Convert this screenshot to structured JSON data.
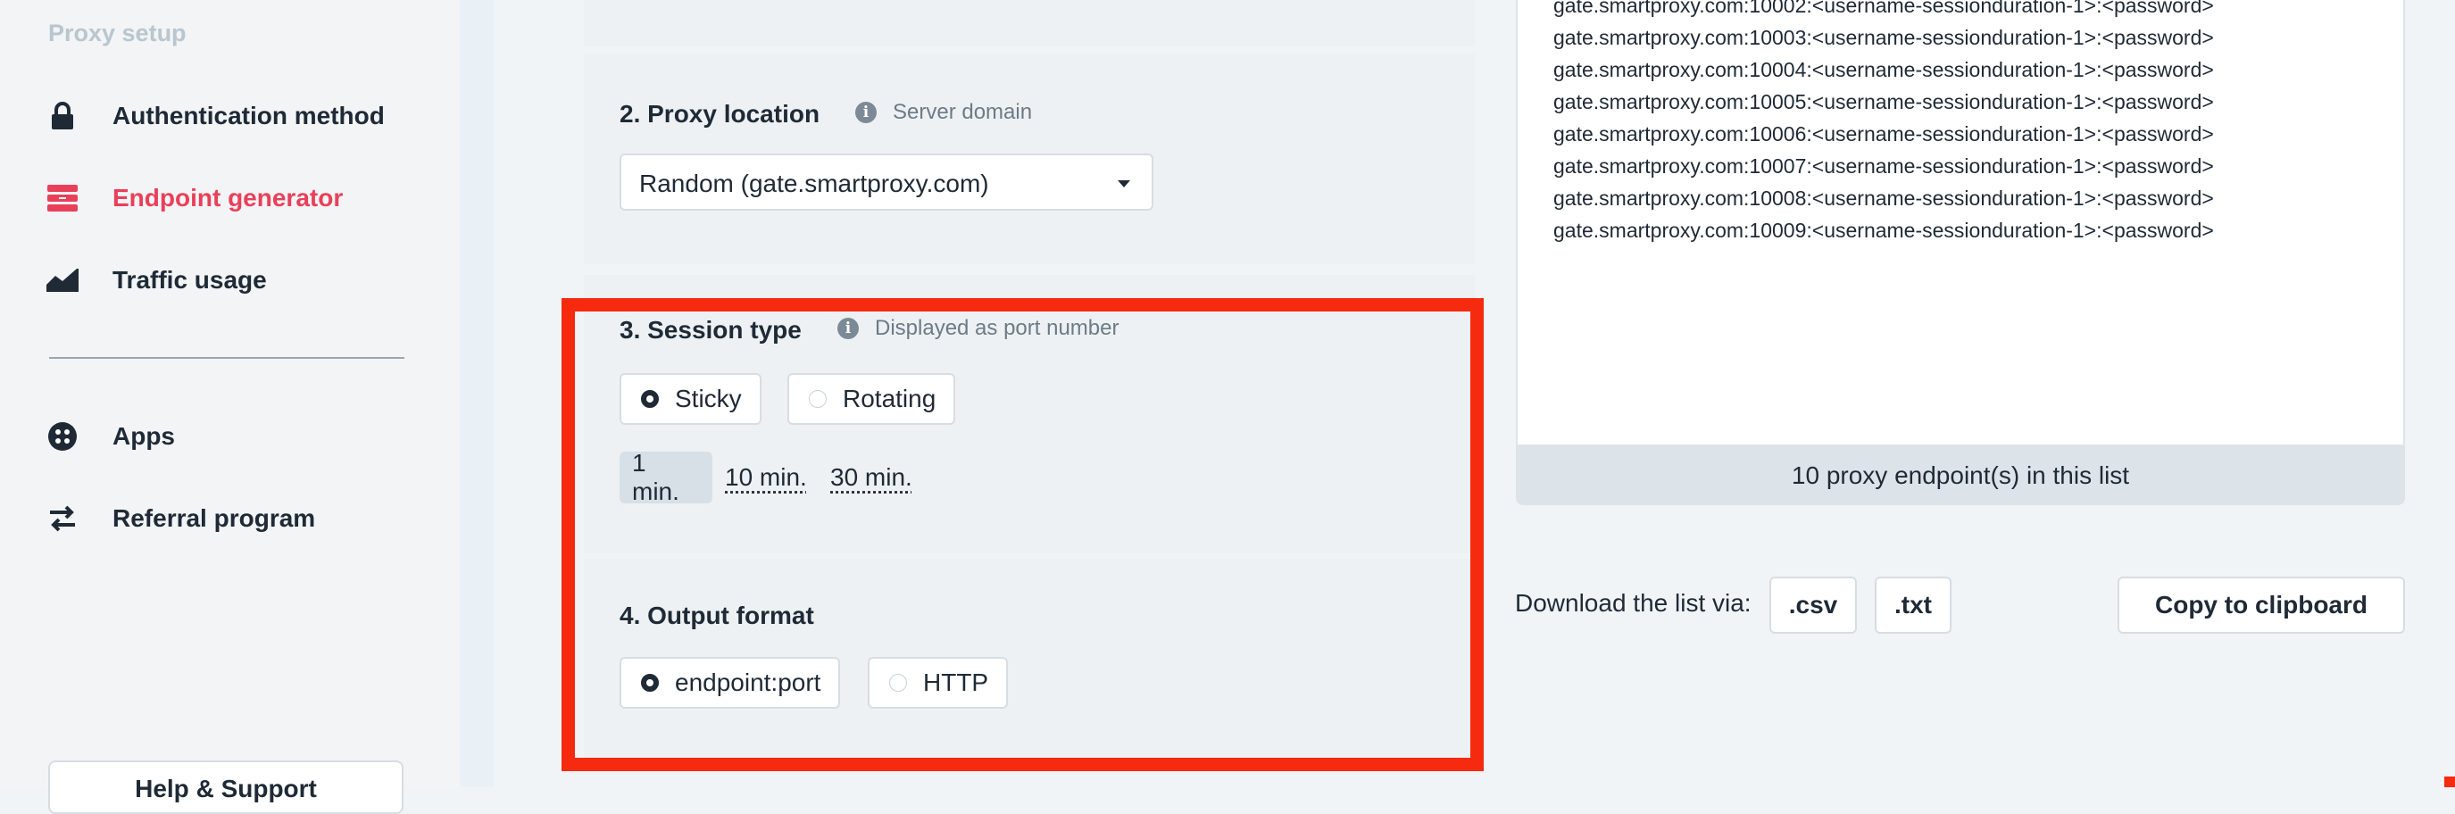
{
  "sidebar": {
    "section_title": "Proxy setup",
    "items": [
      {
        "label": "Authentication method",
        "icon": "lock-icon"
      },
      {
        "label": "Endpoint generator",
        "icon": "server-icon"
      },
      {
        "label": "Traffic usage",
        "icon": "area-chart-icon"
      },
      {
        "label": "Apps",
        "icon": "apps-icon"
      },
      {
        "label": "Referral program",
        "icon": "swap-arrows-icon"
      }
    ],
    "help_button": "Help & Support"
  },
  "proxy_location": {
    "title": "2. Proxy location",
    "hint": "Server domain",
    "selected": "Random  (gate.smartproxy.com)"
  },
  "session_type": {
    "title": "3. Session type",
    "hint": "Displayed as port number",
    "options": [
      "Sticky",
      "Rotating"
    ],
    "selected": "Sticky",
    "durations": [
      "1 min.",
      "10 min.",
      "30 min."
    ],
    "selected_duration": "1 min."
  },
  "output_format": {
    "title": "4. Output format",
    "options": [
      "endpoint:port",
      "HTTP"
    ],
    "selected": "endpoint:port"
  },
  "endpoint_list": {
    "lines": [
      "gate.smartproxy.com:10002:<username-sessionduration-1>:<password>",
      "gate.smartproxy.com:10003:<username-sessionduration-1>:<password>",
      "gate.smartproxy.com:10004:<username-sessionduration-1>:<password>",
      "gate.smartproxy.com:10005:<username-sessionduration-1>:<password>",
      "gate.smartproxy.com:10006:<username-sessionduration-1>:<password>",
      "gate.smartproxy.com:10007:<username-sessionduration-1>:<password>",
      "gate.smartproxy.com:10008:<username-sessionduration-1>:<password>",
      "gate.smartproxy.com:10009:<username-sessionduration-1>:<password>"
    ],
    "count_text": "10 proxy endpoint(s) in this list"
  },
  "download": {
    "label": "Download the list via:",
    "csv": ".csv",
    "txt": ".txt",
    "copy": "Copy to clipboard"
  },
  "colors": {
    "accent": "#e9405a",
    "highlight": "#f52a0f",
    "text": "#1f2a36"
  }
}
